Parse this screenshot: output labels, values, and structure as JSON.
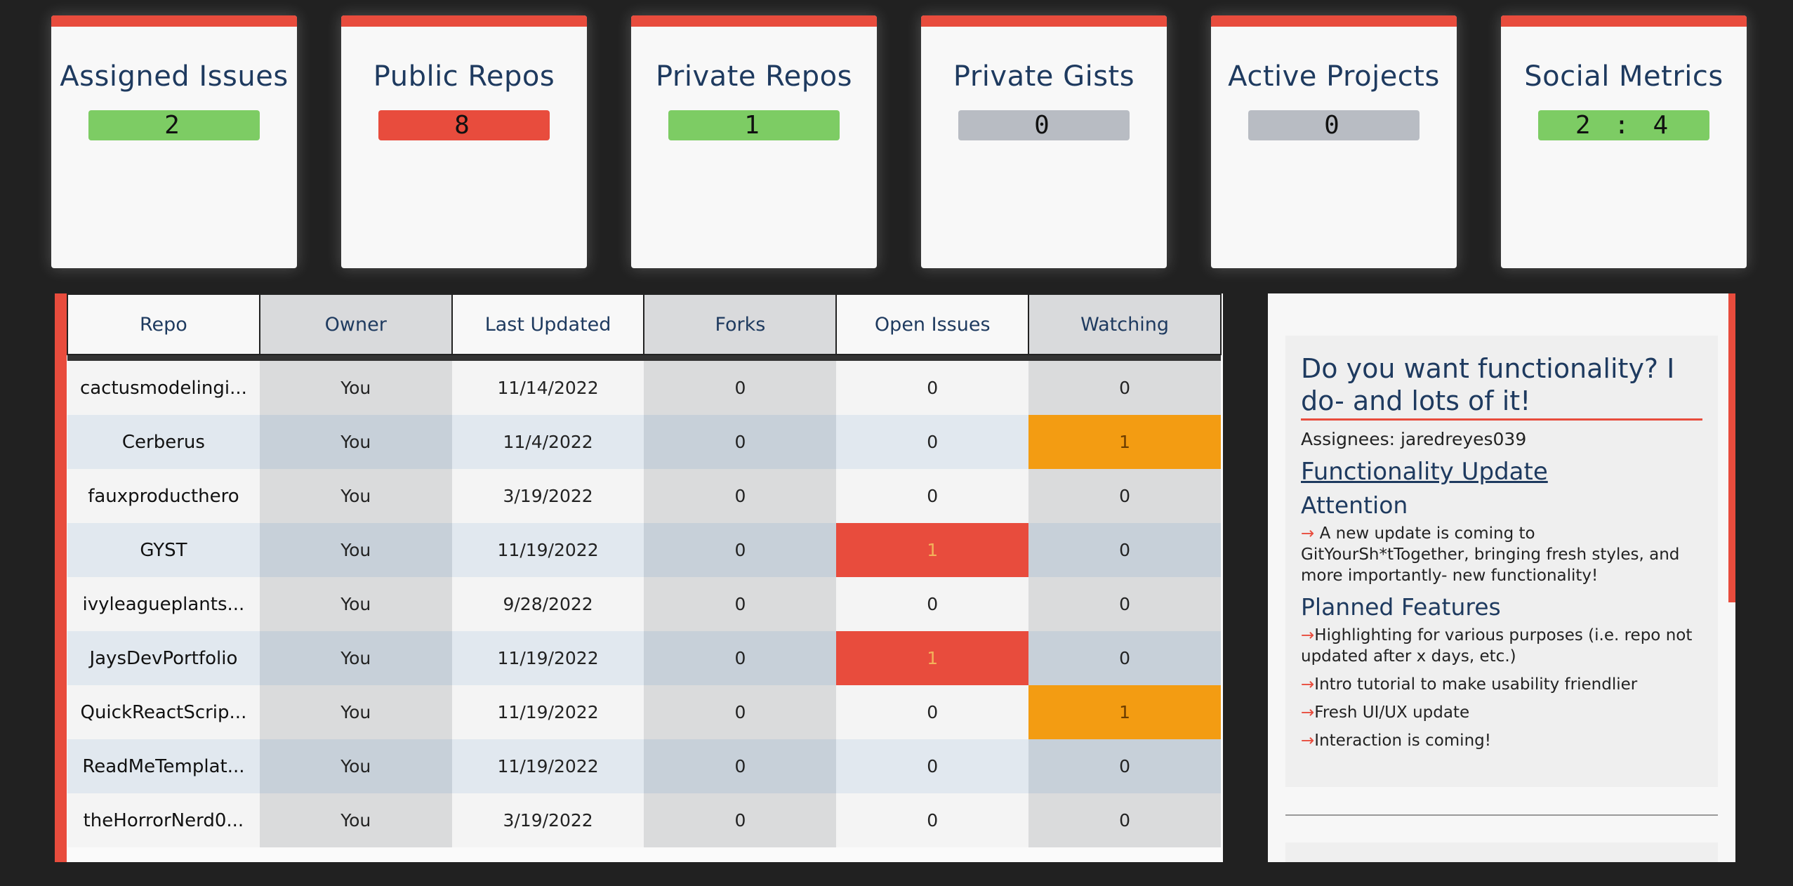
{
  "cards": [
    {
      "title": "Assigned Issues",
      "value": "2",
      "color": "#7dcc64"
    },
    {
      "title": "Public Repos",
      "value": "8",
      "color": "#e84c3d"
    },
    {
      "title": "Private Repos",
      "value": "1",
      "color": "#7dcc64"
    },
    {
      "title": "Private Gists",
      "value": "0",
      "color": "#b8bcc3"
    },
    {
      "title": "Active Projects",
      "value": "0",
      "color": "#b8bcc3"
    },
    {
      "title": "Social Metrics",
      "value": "2 : 4",
      "color": "#7dcc64"
    }
  ],
  "table": {
    "headers": [
      "Repo",
      "Owner",
      "Last Updated",
      "Forks",
      "Open Issues",
      "Watching"
    ],
    "rows": [
      {
        "repo": "cactusmodelingi...",
        "owner": "You",
        "updated": "11/14/2022",
        "forks": "0",
        "issues": "0",
        "watching": "0"
      },
      {
        "repo": "Cerberus",
        "owner": "You",
        "updated": "11/4/2022",
        "forks": "0",
        "issues": "0",
        "watching": "1"
      },
      {
        "repo": "fauxproducthero",
        "owner": "You",
        "updated": "3/19/2022",
        "forks": "0",
        "issues": "0",
        "watching": "0"
      },
      {
        "repo": "GYST",
        "owner": "You",
        "updated": "11/19/2022",
        "forks": "0",
        "issues": "1",
        "watching": "0"
      },
      {
        "repo": "ivyleagueplants...",
        "owner": "You",
        "updated": "9/28/2022",
        "forks": "0",
        "issues": "0",
        "watching": "0"
      },
      {
        "repo": "JaysDevPortfolio",
        "owner": "You",
        "updated": "11/19/2022",
        "forks": "0",
        "issues": "1",
        "watching": "0"
      },
      {
        "repo": "QuickReactScrip...",
        "owner": "You",
        "updated": "11/19/2022",
        "forks": "0",
        "issues": "0",
        "watching": "1"
      },
      {
        "repo": "ReadMeTemplat...",
        "owner": "You",
        "updated": "11/19/2022",
        "forks": "0",
        "issues": "0",
        "watching": "0"
      },
      {
        "repo": "theHorrorNerd0...",
        "owner": "You",
        "updated": "3/19/2022",
        "forks": "0",
        "issues": "0",
        "watching": "0"
      }
    ]
  },
  "note": {
    "title": "Do you want functionality? I do- and lots of it!",
    "assignees": "Assignees: jaredreyes039",
    "update_link": "Functionality Update",
    "attention_heading": "Attention",
    "attention_text": "A new update is coming to GitYourSh*tTogether, bringing fresh styles, and more importantly- new functionality!",
    "planned_heading": "Planned Features",
    "arrow": "→",
    "features": [
      "Highlighting for various purposes (i.e. repo not updated after x days, etc.)",
      "Intro tutorial to make usability friendlier",
      "Fresh UI/UX update",
      "Interaction is coming!"
    ]
  },
  "colors": {
    "background": "#212121",
    "accent": "#e84c3d",
    "title_text": "#1e3a5f",
    "warning": "#f39c12",
    "success": "#7dcc64",
    "neutral": "#b8bcc3"
  }
}
